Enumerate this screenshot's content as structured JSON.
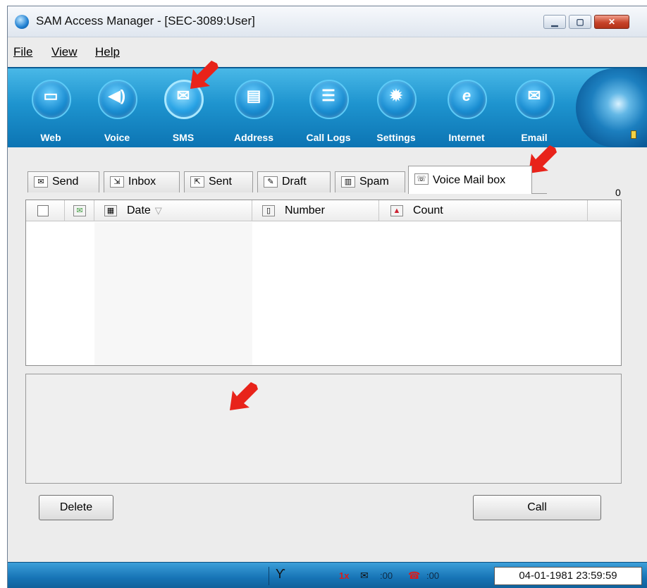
{
  "window": {
    "title": "SAM Access Manager - [SEC-3089:User]"
  },
  "menu": [
    {
      "label": "File"
    },
    {
      "label": "View"
    },
    {
      "label": "Help"
    }
  ],
  "toolbar": [
    {
      "label": "Web",
      "icon": "web-icon"
    },
    {
      "label": "Voice",
      "icon": "speaker-icon"
    },
    {
      "label": "SMS",
      "icon": "envelope-icon",
      "active": true
    },
    {
      "label": "Address",
      "icon": "address-book-icon"
    },
    {
      "label": "Call Logs",
      "icon": "call-log-icon"
    },
    {
      "label": "Settings",
      "icon": "gear-icon"
    },
    {
      "label": "Internet",
      "icon": "internet-explorer-icon"
    },
    {
      "label": "Email",
      "icon": "email-icon"
    }
  ],
  "tabs": [
    {
      "label": "Send"
    },
    {
      "label": "Inbox"
    },
    {
      "label": "Sent"
    },
    {
      "label": "Draft"
    },
    {
      "label": "Spam"
    },
    {
      "label": "Voice Mail box",
      "active": true
    }
  ],
  "tab_count": "0",
  "list": {
    "columns": [
      {
        "label": "Date"
      },
      {
        "label": "Number"
      },
      {
        "label": "Count"
      }
    ],
    "rows": []
  },
  "buttons": {
    "delete": "Delete",
    "call": "Call"
  },
  "status": {
    "network": "1x",
    "msg_time": ":00",
    "call_time": ":00",
    "datetime": "04-01-1981 23:59:59"
  },
  "colors": {
    "toolbar": "#1e94cf",
    "annotation": "#e8231a"
  }
}
